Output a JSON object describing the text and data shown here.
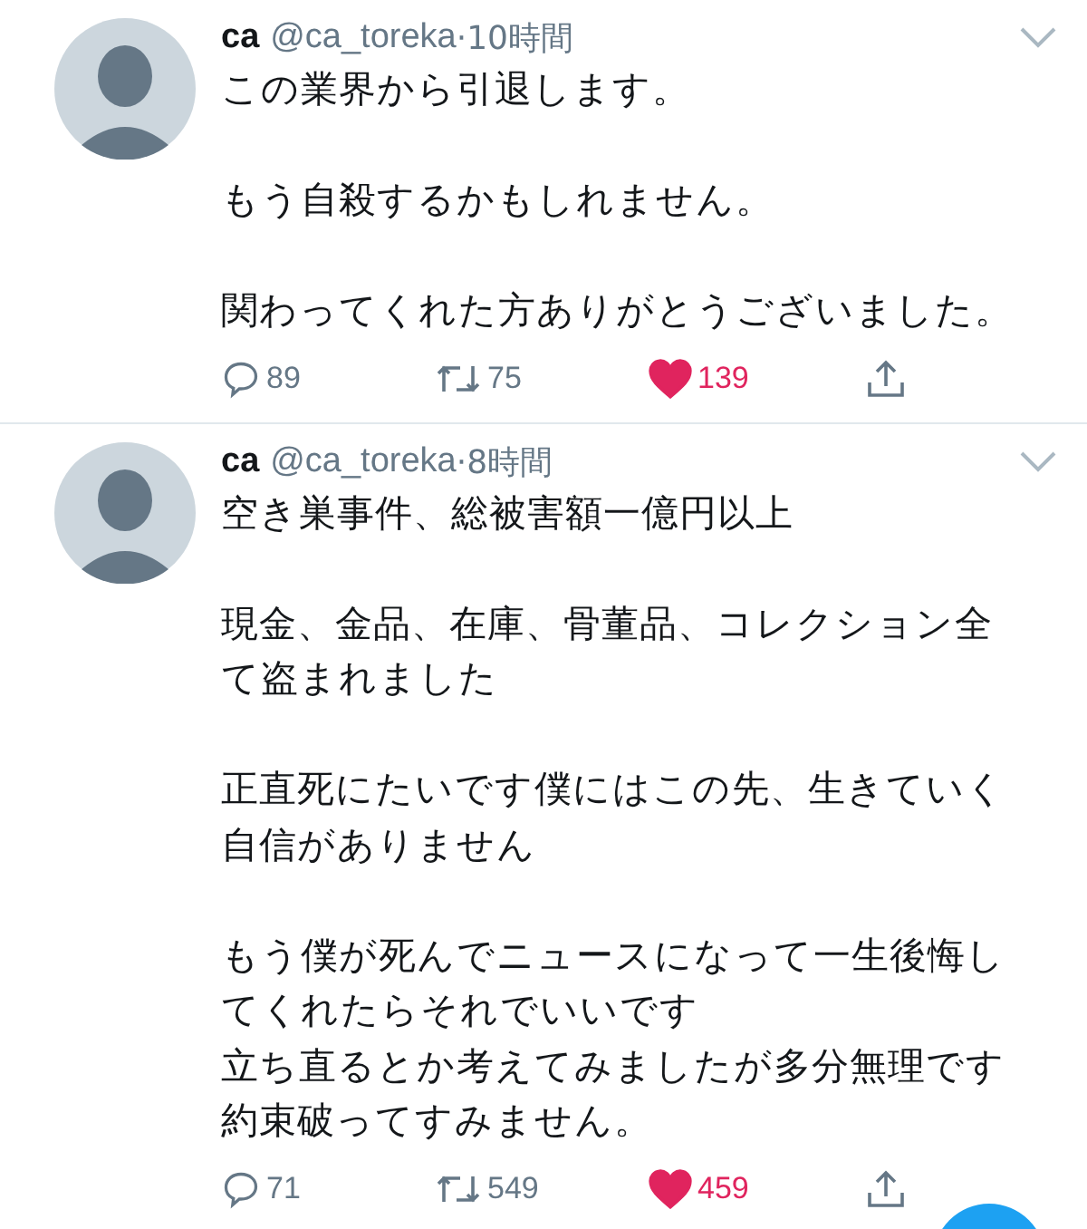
{
  "tweets": [
    {
      "name": "ca",
      "handle": "@ca_toreka",
      "time": "·10時間",
      "paragraphs": [
        [
          "この業界から引退します。"
        ],
        [
          "もう自殺するかもしれません。"
        ],
        [
          "関わってくれた方ありがとうございました。"
        ]
      ],
      "replies": "89",
      "retweets": "75",
      "likes": "139",
      "liked": true
    },
    {
      "name": "ca",
      "handle": "@ca_toreka",
      "time": "·8時間",
      "paragraphs": [
        [
          "空き巣事件、総被害額一億円以上"
        ],
        [
          "現金、金品、在庫、骨董品、コレクション全",
          "て盗まれました"
        ],
        [
          "正直死にたいです僕にはこの先、生きていく",
          "自信がありません"
        ],
        [
          "もう僕が死んでニュースになって一生後悔し",
          "てくれたらそれでいいです",
          "立ち直るとか考えてみましたが多分無理です",
          "約束破ってすみません。"
        ]
      ],
      "replies": "71",
      "retweets": "549",
      "likes": "459",
      "liked": true
    }
  ]
}
